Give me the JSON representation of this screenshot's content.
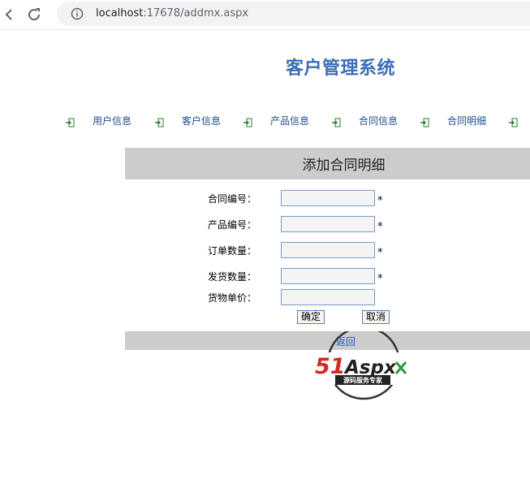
{
  "browser": {
    "url_host": "localhost",
    "url_rest": ":17678/addmx.aspx"
  },
  "page": {
    "title": "客户管理系统",
    "menu": [
      {
        "label": "用户信息"
      },
      {
        "label": "客户信息"
      },
      {
        "label": "产品信息"
      },
      {
        "label": "合同信息"
      },
      {
        "label": "合同明细"
      }
    ],
    "form": {
      "heading": "添加合同明细",
      "fields": [
        {
          "label": "合同编号：",
          "value": "",
          "required": "*"
        },
        {
          "label": "产品编号：",
          "value": "",
          "required": "*"
        },
        {
          "label": "订单数量：",
          "value": "",
          "required": "*"
        },
        {
          "label": "发货数量：",
          "value": "",
          "required": "*"
        },
        {
          "label": "货物单价：",
          "value": ""
        }
      ],
      "confirm_label": "确定",
      "cancel_label": "取消",
      "back_label": "返回"
    },
    "watermark": {
      "brand_51": "51",
      "brand_aspx": "Aspx",
      "tagline": "源码服务专家"
    }
  }
}
